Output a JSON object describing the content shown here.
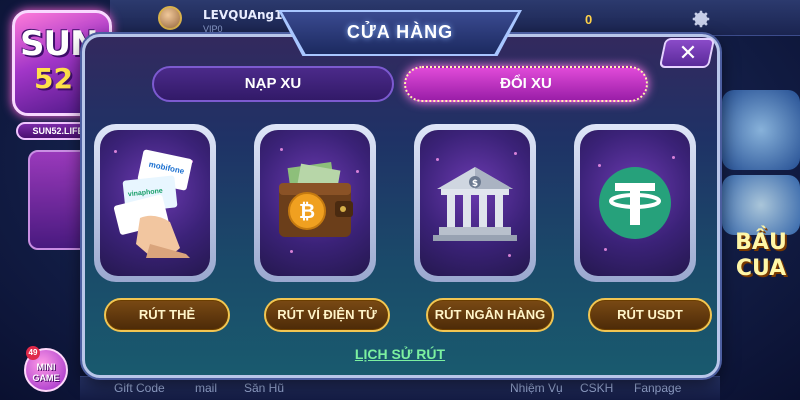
{
  "background": {
    "username": "LEVQUAng1",
    "vip_label": "VIP0",
    "coins": "0",
    "logo": {
      "brand": "SUN",
      "number": "52",
      "site": "SUN52.LIFE"
    },
    "right_game_label": "BẦU CUA",
    "bottom_nav": [
      "Gift Code",
      "mail",
      "Săn Hũ",
      "Nhiệm Vụ",
      "CSKH",
      "Fanpage"
    ],
    "mini_game": {
      "label": "MINI GAME",
      "badge": "49"
    }
  },
  "modal": {
    "title": "CỬA HÀNG",
    "close_symbol": "✕",
    "tabs": [
      {
        "label": "NẠP XU",
        "active": false
      },
      {
        "label": "ĐỔI XU",
        "active": true
      }
    ],
    "options": [
      {
        "label": "RÚT THẺ",
        "icon": "phone-card-icon"
      },
      {
        "label": "RÚT VÍ ĐIỆN TỬ",
        "icon": "bitcoin-wallet-icon"
      },
      {
        "label": "RÚT NGÂN HÀNG",
        "icon": "bank-icon"
      },
      {
        "label": "RÚT USDT",
        "icon": "tether-icon"
      }
    ],
    "history_link": "LỊCH SỬ RÚT"
  },
  "colors": {
    "active_tab": "#d03cc8",
    "button_border": "#f1c552",
    "history_link": "#7cf0a0",
    "tether": "#26a17b"
  }
}
